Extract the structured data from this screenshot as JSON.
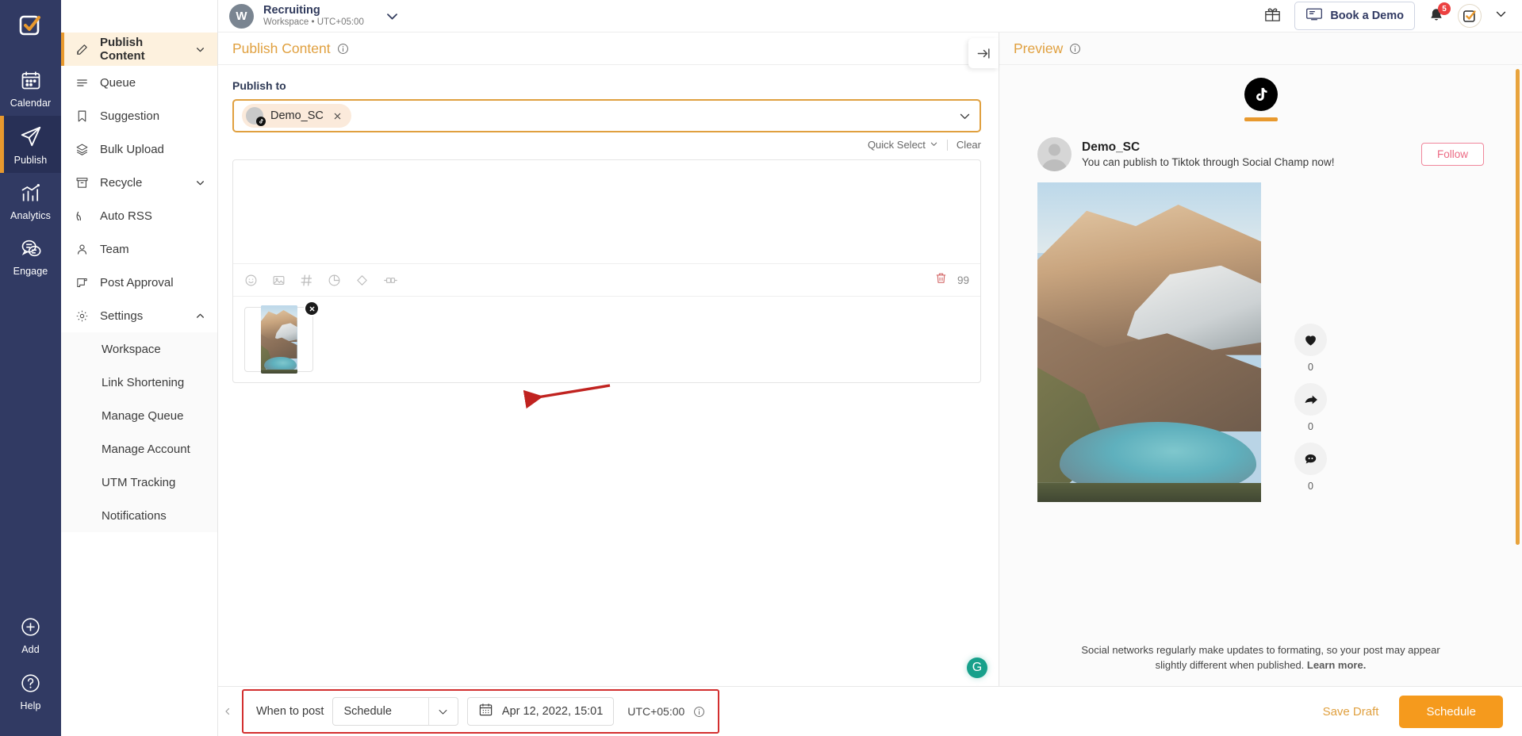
{
  "rail": {
    "logo_icon": "socialchamp-logo-icon",
    "items": [
      {
        "label": "Calendar",
        "icon": "calendar-icon",
        "active": false
      },
      {
        "label": "Publish",
        "icon": "paper-plane-icon",
        "active": true
      },
      {
        "label": "Analytics",
        "icon": "analytics-chart-icon",
        "active": false
      },
      {
        "label": "Engage",
        "icon": "chat-bubbles-icon",
        "active": false
      }
    ],
    "bottom_items": [
      {
        "label": "Add",
        "icon": "plus-circle-icon"
      },
      {
        "label": "Help",
        "icon": "question-circle-icon"
      }
    ]
  },
  "topbar": {
    "workspace_initial": "W",
    "workspace_name": "Recruiting",
    "workspace_sub": "Workspace • UTC+05:00",
    "chevron_icon": "chevron-down-icon",
    "gift_icon": "gift-icon",
    "demo_button": "Book a Demo",
    "demo_icon": "demo-screen-icon",
    "bell_icon": "notification-bell-icon",
    "notification_count": "5",
    "avatar_icon": "user-avatar-icon",
    "avatar_chevron_icon": "chevron-down-icon"
  },
  "sidenav": {
    "items": [
      {
        "label": "Publish Content",
        "icon": "pencil-icon",
        "active": true,
        "chevron": "chevron-down-icon"
      },
      {
        "label": "Queue",
        "icon": "list-icon",
        "active": false
      },
      {
        "label": "Suggestion",
        "icon": "bookmark-icon",
        "active": false
      },
      {
        "label": "Bulk Upload",
        "icon": "layers-icon",
        "active": false
      },
      {
        "label": "Recycle",
        "icon": "archive-icon",
        "active": false,
        "chevron": "chevron-down-icon"
      },
      {
        "label": "Auto RSS",
        "icon": "rss-icon",
        "active": false
      },
      {
        "label": "Team",
        "icon": "person-icon",
        "active": false
      },
      {
        "label": "Post Approval",
        "icon": "scroll-icon",
        "active": false
      },
      {
        "label": "Settings",
        "icon": "gear-icon",
        "active": false,
        "chevron": "chevron-up-icon"
      }
    ],
    "settings_sub": [
      "Workspace",
      "Link Shortening",
      "Manage Queue",
      "Manage Account",
      "UTM Tracking",
      "Notifications"
    ]
  },
  "editor": {
    "title": "Publish Content",
    "title_info_icon": "info-icon",
    "publish_to_label": "Publish to",
    "chip": {
      "name": "Demo_SC",
      "network_icon": "tiktok-icon",
      "remove_icon": "close-icon"
    },
    "select_chevron_icon": "chevron-down-icon",
    "quick_select": "Quick Select",
    "quick_select_icon": "chevron-down-icon",
    "clear": "Clear",
    "composer_text": "",
    "composer_placeholder": "",
    "grammarly_icon": "grammarly-icon",
    "grammarly_letter": "G",
    "tools": [
      "emoji-icon",
      "image-icon",
      "hashtag-icon",
      "pie-chart-icon",
      "tag-icon",
      "link-icon"
    ],
    "delete_icon": "trash-icon",
    "char_count": "99",
    "attachment": {
      "remove_icon": "close-icon",
      "alt": "mountain-lake-thumbnail"
    },
    "collapse_icon": "collapse-right-icon"
  },
  "preview": {
    "title": "Preview",
    "title_info_icon": "info-icon",
    "network_icon": "tiktok-icon",
    "user": "Demo_SC",
    "caption": "You can publish to Tiktok through Social Champ now!",
    "follow_label": "Follow",
    "avatar_icon": "user-avatar-icon",
    "engagements": [
      {
        "icon": "heart-icon",
        "count": "0"
      },
      {
        "icon": "share-arrow-icon",
        "count": "0"
      },
      {
        "icon": "comment-icon",
        "count": "0"
      }
    ],
    "disclaimer": "Social networks regularly make updates to formating, so your post may appear slightly different when published.",
    "learn_more": "Learn more."
  },
  "bottombar": {
    "collapse_icon": "chevron-left-icon",
    "when_to_post_label": "When to post",
    "schedule_mode": "Schedule",
    "schedule_mode_icon": "chevron-down-icon",
    "calendar_icon": "calendar-icon",
    "date_value": "Apr 12, 2022, 15:01",
    "timezone": "UTC+05:00",
    "timezone_info_icon": "info-icon",
    "save_draft": "Save Draft",
    "schedule_button": "Schedule"
  },
  "colors": {
    "rail_bg": "#313a63",
    "accent_orange": "#e8992e",
    "schedule_button": "#f59a1d",
    "highlight_red": "#d32f2f",
    "notification_red": "#ec4040",
    "grammarly_green": "#17a08b"
  }
}
